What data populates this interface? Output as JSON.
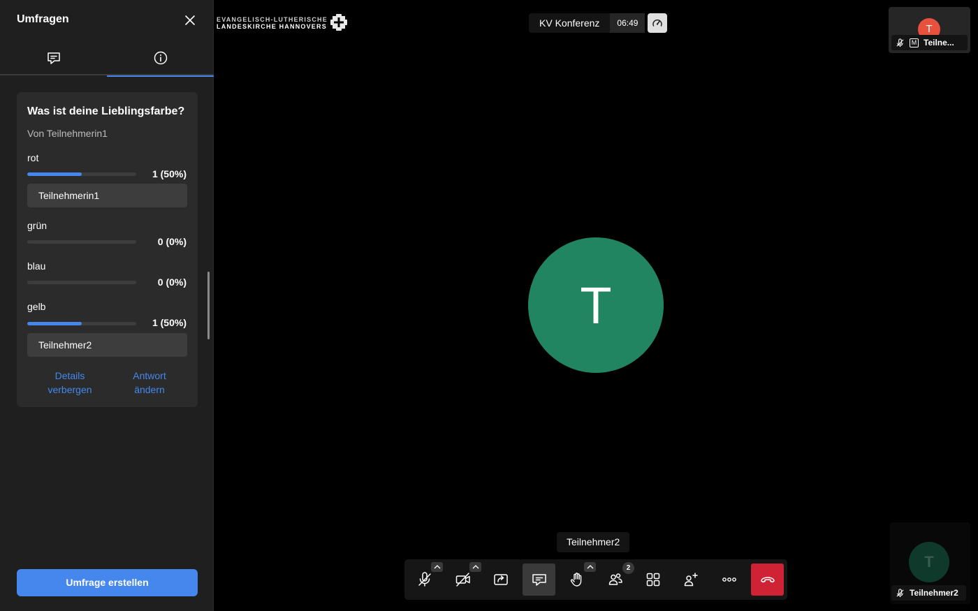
{
  "sidebar": {
    "title": "Umfragen",
    "tabs": [
      {
        "icon": "chat-icon",
        "active": false
      },
      {
        "icon": "info-icon",
        "active": true
      }
    ],
    "poll": {
      "question": "Was ist deine Lieblingsfarbe?",
      "author": "Von Teilnehmerin1",
      "options": [
        {
          "label": "rot",
          "count": "1 (50%)",
          "percent": 50,
          "voter": "Teilnehmerin1"
        },
        {
          "label": "grün",
          "count": "0 (0%)",
          "percent": 0
        },
        {
          "label": "blau",
          "count": "0 (0%)",
          "percent": 0
        },
        {
          "label": "gelb",
          "count": "1 (50%)",
          "percent": 50,
          "voter": "Teilnehmer2"
        }
      ],
      "hide_details_label": "Details verbergen",
      "change_answer_label": "Antwort ändern"
    },
    "create_label": "Umfrage erstellen"
  },
  "header": {
    "logo_line1": "EVANGELISCH-LUTHERISCHE",
    "logo_line2": "LANDESKIRCHE HANNOVERS",
    "conference_name": "KV Konferenz",
    "timer": "06:49"
  },
  "stage": {
    "avatar_letter": "T",
    "avatar_color": "#228561",
    "speaker_name": "Teilnehmer2"
  },
  "thumbnails": [
    {
      "letter": "T",
      "name": "Teilne...",
      "color": "#e8513e",
      "moderator_badge": "M"
    },
    {
      "letter": "T",
      "name": "Teilnehmer2",
      "color": "#0f3a2b"
    }
  ],
  "toolbar": {
    "participants_count": "2",
    "hangup_color": "#cf2234",
    "accent_color": "#4687ed"
  }
}
